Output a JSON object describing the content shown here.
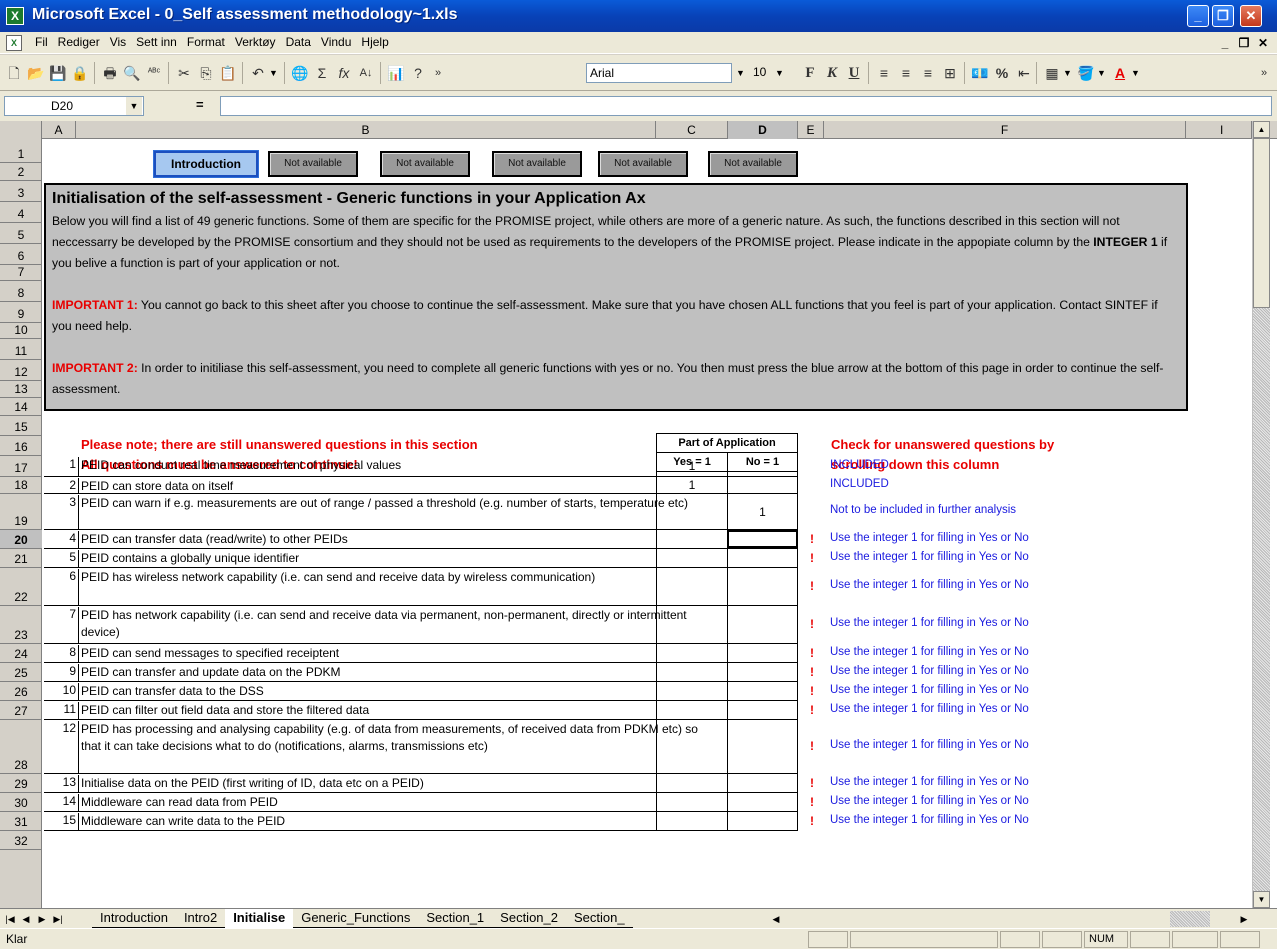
{
  "window": {
    "title": "Microsoft Excel - 0_Self assessment methodology~1.xls",
    "app_icon": "X",
    "controls": [
      "minimize-icon",
      "maximize-icon",
      "close-icon"
    ]
  },
  "menu": {
    "items": [
      "Fil",
      "Rediger",
      "Vis",
      "Sett inn",
      "Format",
      "Verktøy",
      "Data",
      "Vindu",
      "Hjelp"
    ]
  },
  "toolbar": {
    "font_name": "Arial",
    "font_size": "10",
    "bold": "F",
    "italic": "K",
    "underline": "U"
  },
  "formula_bar": {
    "cell_ref": "D20",
    "equals": "=",
    "value": ""
  },
  "columns": [
    "A",
    "B",
    "C",
    "D",
    "E",
    "F",
    "I"
  ],
  "active_column": "D",
  "active_row": "20",
  "nav_buttons": [
    "Introduction",
    "Not available",
    "Not available",
    "Not available",
    "Not available",
    "Not available"
  ],
  "intro": {
    "heading": "Initialisation of the self-assessment - Generic functions in your Application Ax",
    "para1_a": "Below you will find a list of 49 generic functions. Some of them are specific for the PROMISE project, while others are more of a generic nature. As such, the functions described in this section will not neccessarry be developed by the PROMISE consortium and they should not be used as requirements to the developers of the PROMISE project. Please indicate in the appopiate column by the ",
    "para1_bold": "INTEGER 1",
    "para1_b": " if you belive a function is part of your application or not.",
    "imp1_label": "IMPORTANT 1:",
    "imp1_text": " You cannot go back to this sheet after you choose to continue the self-assessment. Make sure that you have chosen ALL functions that you feel is part of your application. Contact SINTEF if you need help.",
    "imp2_label": "IMPORTANT 2:",
    "imp2_text": " In order to initiliase this self-assessment, you need to complete all generic functions with yes or no. You then must press the blue arrow at the bottom of this page in order to continue the self-assessment."
  },
  "notes": {
    "line1": "Please note; there are still unanswered questions in this section",
    "line2": "All questions must be answered to continue!",
    "check1": "Check for unanswered questions by",
    "check2": "scrolling down this column"
  },
  "table_header": {
    "group": "Part of Application",
    "yes": "Yes = 1",
    "no": "No = 1"
  },
  "rows": [
    {
      "row": "17",
      "num": "1",
      "desc": "PEID can conduct real time measurement of physical values",
      "yes": "1",
      "no": "",
      "status": "INCLUDED",
      "bang": ""
    },
    {
      "row": "18",
      "num": "2",
      "desc": "PEID can store data on itself",
      "yes": "1",
      "no": "",
      "status": "INCLUDED",
      "bang": ""
    },
    {
      "row": "19",
      "num": "3",
      "desc": "PEID can warn if e.g. measurements are out of range / passed a threshold (e.g. number of starts, temperature etc)",
      "yes": "",
      "no": "1",
      "status": "Not to be included in further analysis",
      "bang": ""
    },
    {
      "row": "20",
      "num": "4",
      "desc": "PEID can transfer data (read/write) to other PEIDs",
      "yes": "",
      "no": "",
      "status": "Use the integer 1 for filling in Yes or No",
      "bang": "!"
    },
    {
      "row": "21",
      "num": "5",
      "desc": "PEID contains a globally unique identifier",
      "yes": "",
      "no": "",
      "status": "Use the integer 1 for filling in Yes or No",
      "bang": "!"
    },
    {
      "row": "22",
      "num": "6",
      "desc": "PEID has wireless network capability (i.e. can send and receive data by wireless communication)",
      "yes": "",
      "no": "",
      "status": "Use the integer 1 for filling in Yes or No",
      "bang": "!"
    },
    {
      "row": "23",
      "num": "7",
      "desc": "PEID has network capability (i.e. can send and receive data via permanent, non-permanent, directly or intermittent device)",
      "yes": "",
      "no": "",
      "status": "Use the integer 1 for filling in Yes or No",
      "bang": "!"
    },
    {
      "row": "24",
      "num": "8",
      "desc": "PEID can send messages to specified receiptent",
      "yes": "",
      "no": "",
      "status": "Use the integer 1 for filling in Yes or No",
      "bang": "!"
    },
    {
      "row": "25",
      "num": "9",
      "desc": "PEID can transfer and update data on the PDKM",
      "yes": "",
      "no": "",
      "status": "Use the integer 1 for filling in Yes or No",
      "bang": "!"
    },
    {
      "row": "26",
      "num": "10",
      "desc": "PEID can transfer data to the DSS",
      "yes": "",
      "no": "",
      "status": "Use the integer 1 for filling in Yes or No",
      "bang": "!"
    },
    {
      "row": "27",
      "num": "11",
      "desc": "PEID can filter out field data and store the filtered data",
      "yes": "",
      "no": "",
      "status": "Use the integer 1 for filling in Yes or No",
      "bang": "!"
    },
    {
      "row": "28",
      "num": "12",
      "desc": "PEID has processing and analysing capability (e.g. of data from measurements, of received data from PDKM etc) so that it can take decisions what to do (notifications, alarms, transmissions etc)",
      "yes": "",
      "no": "",
      "status": "Use the integer 1 for filling in Yes or No",
      "bang": "!"
    },
    {
      "row": "29",
      "num": "13",
      "desc": "Initialise data on the PEID (first writing of ID, data etc on a PEID)",
      "yes": "",
      "no": "",
      "status": "Use the integer 1 for filling in Yes or No",
      "bang": "!"
    },
    {
      "row": "30",
      "num": "14",
      "desc": "Middleware can read data from PEID",
      "yes": "",
      "no": "",
      "status": "Use the integer 1 for filling in Yes or No",
      "bang": "!"
    },
    {
      "row": "31",
      "num": "15",
      "desc": "Middleware can write data to the PEID",
      "yes": "",
      "no": "",
      "status": "Use the integer 1 for filling in Yes or No",
      "bang": "!"
    }
  ],
  "sheet_tabs": [
    "Introduction",
    "Intro2",
    "Initialise",
    "Generic_Functions",
    "Section_1",
    "Section_2",
    "Section_"
  ],
  "active_tab": "Initialise",
  "statusbar": {
    "text": "Klar",
    "num": "NUM"
  }
}
